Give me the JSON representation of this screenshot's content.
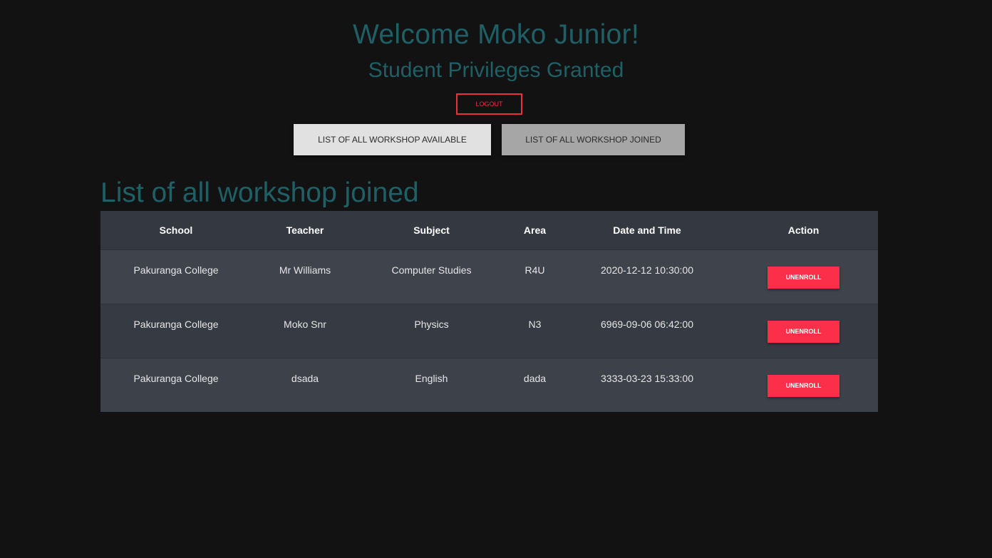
{
  "header": {
    "welcome": "Welcome Moko Junior!",
    "privileges": "Student Privileges Granted",
    "logout_label": "LOGOUT"
  },
  "nav": {
    "available_label": "LIST OF ALL WORKSHOP AVAILABLE",
    "joined_label": "LIST OF ALL WORKSHOP JOINED"
  },
  "section": {
    "title": "List of all workshop joined"
  },
  "table": {
    "columns": [
      "School",
      "Teacher",
      "Subject",
      "Area",
      "Date and Time",
      "Action"
    ],
    "rows": [
      {
        "school": "Pakuranga College",
        "teacher": "Mr Williams",
        "subject": "Computer Studies",
        "area": "R4U",
        "datetime": "2020-12-12 10:30:00",
        "action": "UNENROLL"
      },
      {
        "school": "Pakuranga College",
        "teacher": "Moko Snr",
        "subject": "Physics",
        "area": "N3",
        "datetime": "6969-09-06 06:42:00",
        "action": "UNENROLL"
      },
      {
        "school": "Pakuranga College",
        "teacher": "dsada",
        "subject": "English",
        "area": "dada",
        "datetime": "3333-03-23 15:33:00",
        "action": "UNENROLL"
      }
    ]
  },
  "colors": {
    "background": "#121212",
    "heading_teal": "#1f5f66",
    "logout_red": "#e8333f",
    "unenroll_red": "#fc2f4a",
    "table_header": "#343840",
    "table_body": "#3d414a"
  }
}
